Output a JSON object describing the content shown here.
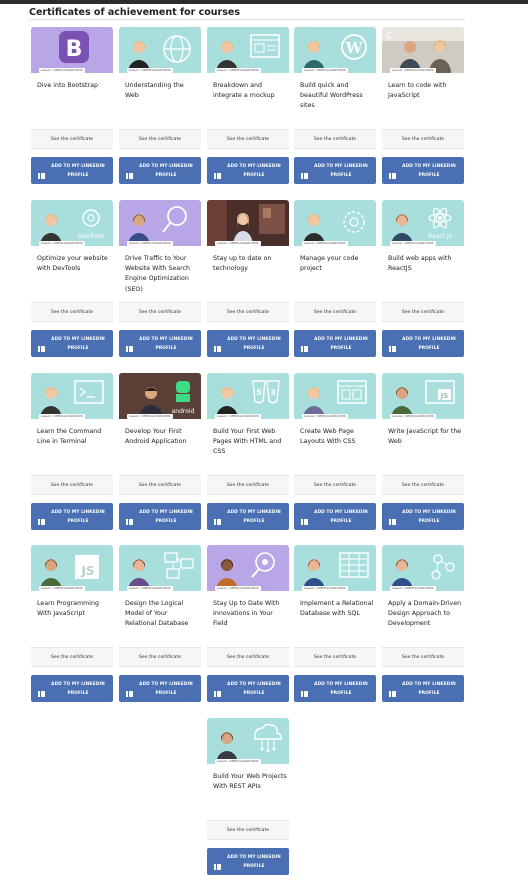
{
  "section": {
    "title": "Certificates of achievement for courses"
  },
  "colors": {
    "linkedin_button": "#4a6fb3",
    "thumb_teal": "#a8dfdc",
    "thumb_purple": "#b9a6e6",
    "bootstrap_purple": "#7952b3"
  },
  "labels": {
    "see_certificate": "See the certificate",
    "add_linkedin": "ADD TO MY LINKEDIN PROFILE",
    "thumb_tag": "Lesson: OPENCLASSROOMS"
  },
  "courses": [
    {
      "name": "Dive into Bootstrap",
      "thumb": "bootstrap-logo"
    },
    {
      "name": "Understanding the Web",
      "thumb": "globe"
    },
    {
      "name": "Breakdown and integrate a mockup",
      "thumb": "mockup"
    },
    {
      "name": "Build quick and beautiful WordPress sites",
      "thumb": "wordpress"
    },
    {
      "name": "Learn to code with JavaScript",
      "thumb": "photo-people"
    },
    {
      "name": "Optimize your website with DevTools",
      "thumb": "devtools"
    },
    {
      "name": "Drive Traffic to Your Website With Search Engine Optimization (SEO)",
      "thumb": "search"
    },
    {
      "name": "Stay up to date on technology",
      "thumb": "photo-office"
    },
    {
      "name": "Manage your code project",
      "thumb": "code-project"
    },
    {
      "name": "Build web apps with ReactJS",
      "thumb": "react"
    },
    {
      "name": "Learn the Command Line in Terminal",
      "thumb": "terminal"
    },
    {
      "name": "Develop Your First Android Application",
      "thumb": "android"
    },
    {
      "name": "Build Your First Web Pages With HTML and CSS",
      "thumb": "html-css"
    },
    {
      "name": "Create Web Page Layouts With CSS",
      "thumb": "layouts"
    },
    {
      "name": "Write JavaScript for the Web",
      "thumb": "js-web"
    },
    {
      "name": "Learn Programming With JavaScript",
      "thumb": "js"
    },
    {
      "name": "Design the Logical Model of Your Relational Database",
      "thumb": "database-model"
    },
    {
      "name": "Stay Up to Date With Innovations in Your Field",
      "thumb": "innovations"
    },
    {
      "name": "Implement a Relational Database with SQL",
      "thumb": "sql"
    },
    {
      "name": "Apply a Domain-Driven Design Approach to Development",
      "thumb": "ddd"
    },
    {
      "name": "Build Your Web Projects With REST APIs",
      "thumb": "rest-api"
    }
  ]
}
